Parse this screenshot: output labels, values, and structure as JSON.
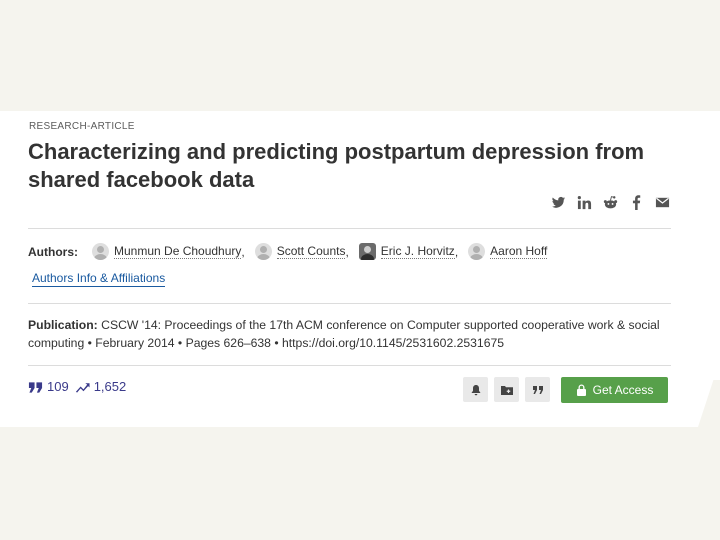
{
  "article": {
    "type": "RESEARCH-ARTICLE",
    "title": "Characterizing and predicting postpartum depression from shared facebook data"
  },
  "share": {
    "icons": [
      "twitter-icon",
      "linkedin-icon",
      "reddit-icon",
      "facebook-icon",
      "email-icon"
    ]
  },
  "authors": {
    "label": "Authors:",
    "list": [
      {
        "name": "Munmun De Choudhury",
        "sep": ","
      },
      {
        "name": "Scott Counts",
        "sep": ","
      },
      {
        "name": "Eric J. Horvitz",
        "sep": ","
      },
      {
        "name": "Aaron Hoff",
        "sep": ""
      }
    ],
    "info_link": "Authors Info & Affiliations"
  },
  "publication": {
    "label": "Publication:",
    "text": "CSCW '14: Proceedings of the 17th ACM conference on Computer supported cooperative work & social computing • February 2014 • Pages 626–638 • https://doi.org/10.1145/2531602.2531675"
  },
  "metrics": {
    "citations": "109",
    "downloads": "1,652"
  },
  "actions": {
    "get_access": "Get Access"
  },
  "colors": {
    "accent_green": "#57a04a",
    "metric_purple": "#3a3a8a",
    "link_blue": "#1a5aa0"
  }
}
